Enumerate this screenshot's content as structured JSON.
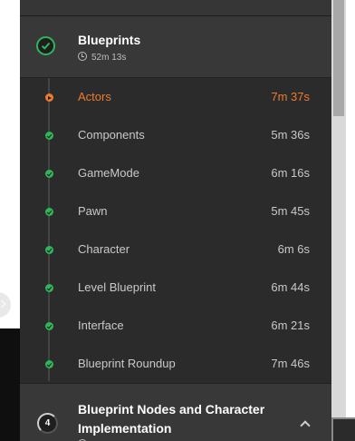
{
  "section": {
    "title": "Blueprints",
    "duration": "52m 13s",
    "status": "completed"
  },
  "lessons": [
    {
      "title": "Actors",
      "duration": "7m 37s",
      "state": "current"
    },
    {
      "title": "Components",
      "duration": "5m 36s",
      "state": "completed"
    },
    {
      "title": "GameMode",
      "duration": "6m 16s",
      "state": "completed"
    },
    {
      "title": "Pawn",
      "duration": "5m 45s",
      "state": "completed"
    },
    {
      "title": "Character",
      "duration": "6m 6s",
      "state": "completed"
    },
    {
      "title": "Level Blueprint",
      "duration": "6m 44s",
      "state": "completed"
    },
    {
      "title": "Interface",
      "duration": "6m 21s",
      "state": "completed"
    },
    {
      "title": "Blueprint Roundup",
      "duration": "7m 46s",
      "state": "completed"
    }
  ],
  "next_section": {
    "number": "4",
    "title": "Blueprint Nodes and Character Implementation",
    "duration": ""
  },
  "colors": {
    "accent": "#ee7b2e",
    "completed": "#2fb55a",
    "panel": "#2b2b2b"
  }
}
